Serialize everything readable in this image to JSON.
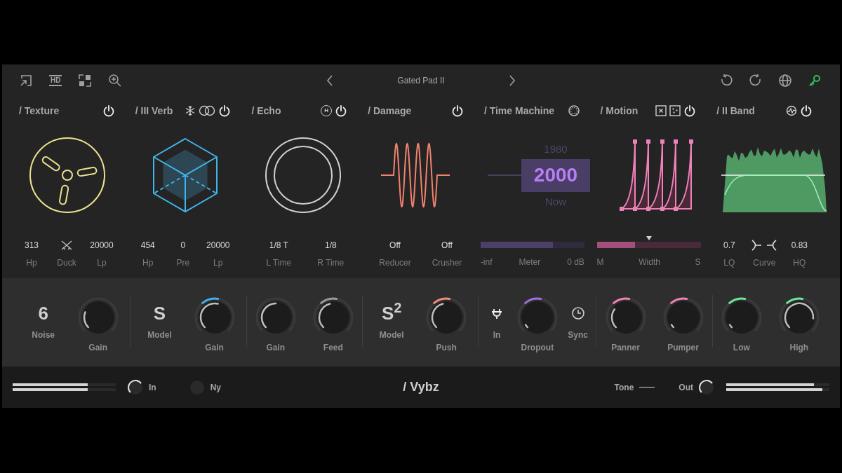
{
  "toolbar": {
    "hd_badge": "HD"
  },
  "preset": {
    "name": "Gated Pad II"
  },
  "modules": [
    {
      "kind": "texture",
      "title": "/ Texture",
      "power": true,
      "params": [
        {
          "value": "313",
          "label": "Hp"
        },
        {
          "kind": "icon",
          "label": "Duck"
        },
        {
          "value": "20000",
          "label": "Lp"
        }
      ]
    },
    {
      "kind": "verb",
      "title": "/ III Verb",
      "power": true,
      "params": [
        {
          "value": "454",
          "label": "Hp"
        },
        {
          "value": "0",
          "label": "Pre"
        },
        {
          "value": "20000",
          "label": "Lp"
        }
      ]
    },
    {
      "kind": "echo",
      "title": "/ Echo",
      "badge": "H",
      "power": true,
      "params": [
        {
          "value": "1/8 T",
          "label": "L Time"
        },
        {
          "value": "1/8",
          "label": "R Time"
        }
      ]
    },
    {
      "kind": "damage",
      "title": "/ Damage",
      "power": true,
      "params": [
        {
          "value": "Off",
          "label": "Reducer"
        },
        {
          "value": "Off",
          "label": "Crusher"
        }
      ]
    },
    {
      "kind": "time_machine",
      "title": "/ Time Machine",
      "display": {
        "above": "1980",
        "value": "2000",
        "below": "Now"
      },
      "bar": {
        "level": 0.7,
        "left": "-inf",
        "center": "Meter",
        "right": "0 dB"
      }
    },
    {
      "kind": "motion",
      "title": "/ Motion",
      "power": true,
      "bar": {
        "level": 0.37,
        "left": "M",
        "center": "Width",
        "right": "S"
      }
    },
    {
      "kind": "band",
      "title": "/ II Band",
      "power": true,
      "params": [
        {
          "value": "0.7",
          "label": "LQ"
        },
        {
          "kind": "icon",
          "label": "Curve"
        },
        {
          "value": "0.83",
          "label": "HQ"
        }
      ]
    }
  ],
  "controls": [
    [
      {
        "kind": "value",
        "value": "6",
        "label": "Noise"
      },
      {
        "kind": "knob",
        "label": "Gain"
      }
    ],
    [
      {
        "kind": "value",
        "value": "S",
        "label": "Model"
      },
      {
        "kind": "knob",
        "label": "Gain"
      }
    ],
    [
      {
        "kind": "knob",
        "label": "Gain"
      },
      {
        "kind": "knob",
        "label": "Feed"
      }
    ],
    [
      {
        "kind": "value",
        "value": "S$^{2}$",
        "label": "Model"
      },
      {
        "kind": "knob",
        "label": "Push"
      }
    ],
    [
      {
        "kind": "toggle",
        "label": "In"
      },
      {
        "kind": "knob",
        "label": "Dropout"
      },
      {
        "kind": "toggle",
        "label": "Sync"
      }
    ],
    [
      {
        "kind": "knob",
        "label": "Panner"
      },
      {
        "kind": "knob",
        "label": "Pumper"
      }
    ],
    [
      {
        "kind": "knob",
        "label": "Low"
      },
      {
        "kind": "knob",
        "label": "High"
      }
    ]
  ],
  "footer": {
    "input_meters": [
      {
        "level": 0.73
      },
      {
        "level": 0.73
      }
    ],
    "knobs": [
      {
        "label": "In"
      },
      {
        "label": "Ny"
      }
    ],
    "title": "/ Vybz",
    "tone": "Tone",
    "output_knob": {
      "label": "Out"
    },
    "output_meters": [
      {
        "level": 0.85
      },
      {
        "level": 0.93
      }
    ]
  }
}
